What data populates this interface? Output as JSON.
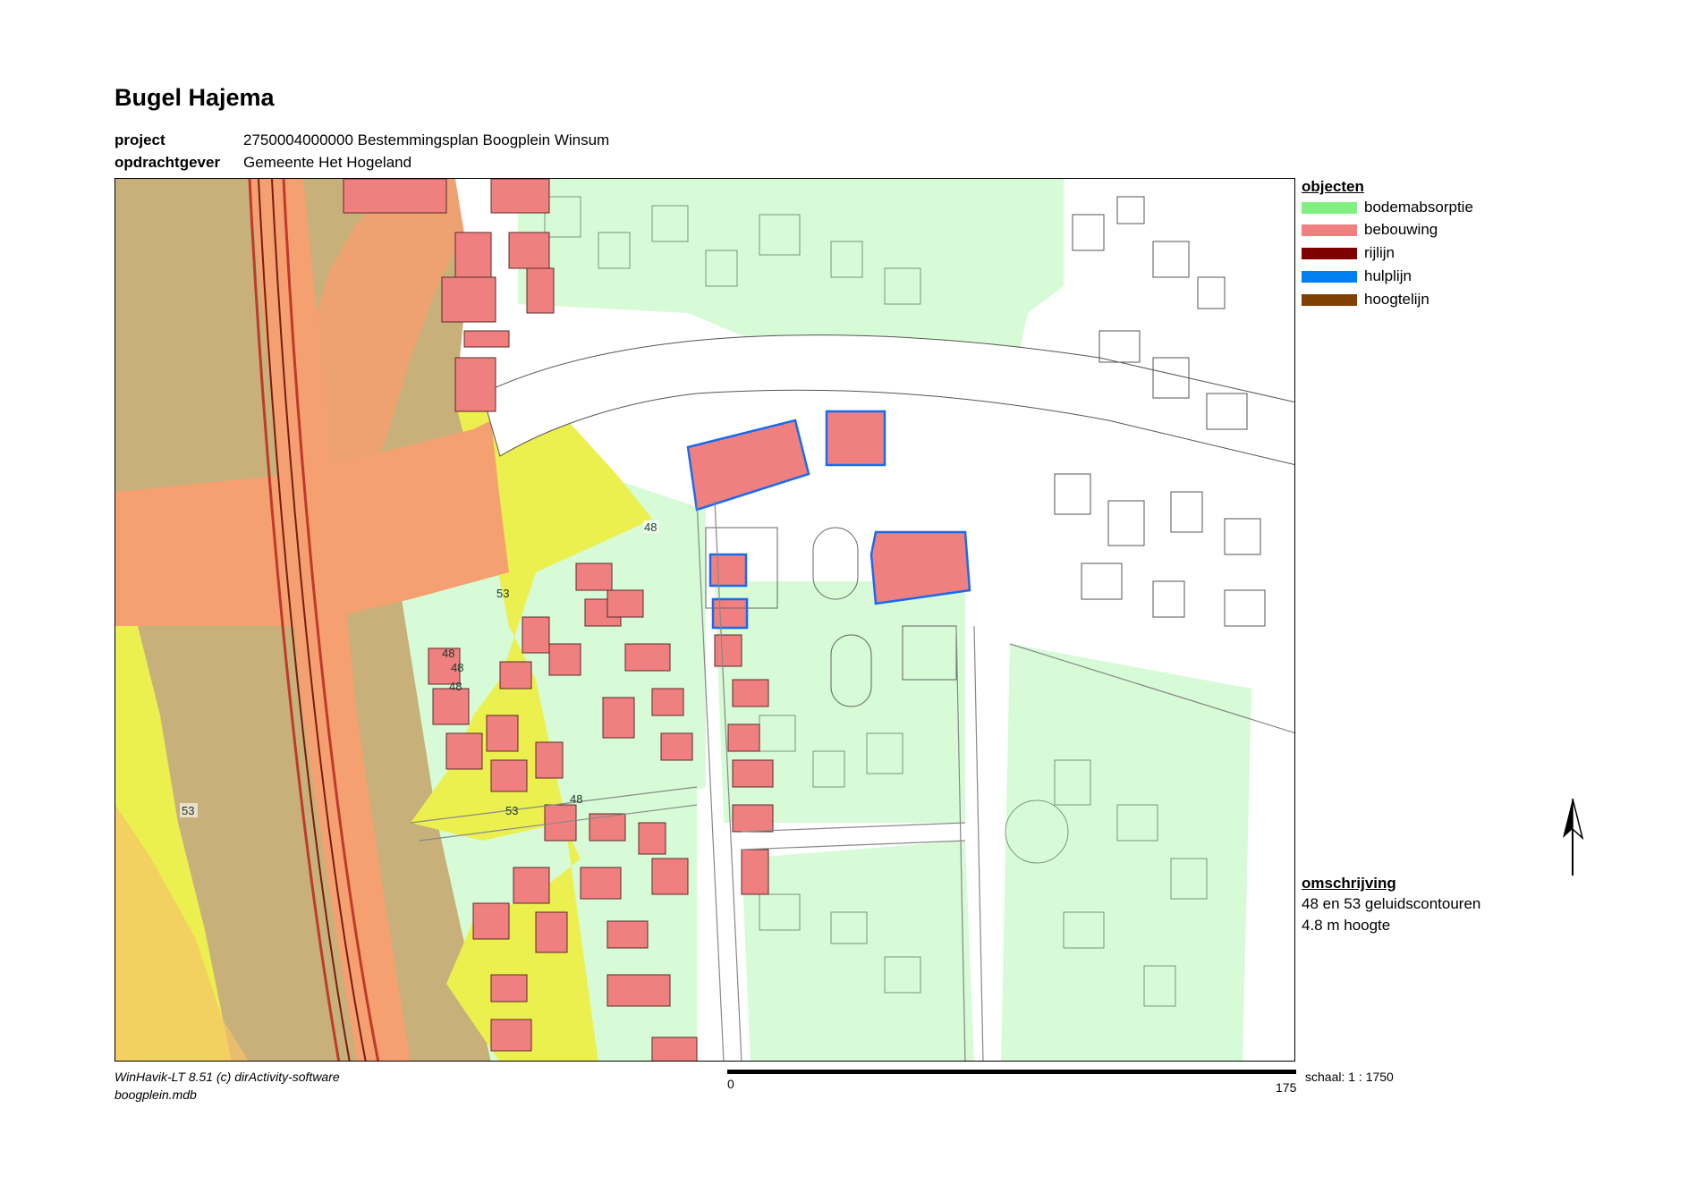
{
  "title": "Bugel Hajema",
  "meta": [
    {
      "label": "project",
      "value": "2750004000000 Bestemmingsplan Boogplein Winsum"
    },
    {
      "label": "opdrachtgever",
      "value": "Gemeente Het Hogeland"
    }
  ],
  "legend": {
    "heading": "objecten",
    "items": [
      {
        "label": "bodemabsorptie",
        "color": "#80f080"
      },
      {
        "label": "bebouwing",
        "color": "#f08080"
      },
      {
        "label": "rijlijn",
        "color": "#800000"
      },
      {
        "label": "hulplijn",
        "color": "#0080f0"
      },
      {
        "label": "hoogtelijn",
        "color": "#804000"
      }
    ]
  },
  "description": {
    "heading": "omschrijving",
    "lines": [
      "48 en 53 geluidscontouren",
      "4.8 m hoogte"
    ]
  },
  "footer": {
    "software": "WinHavik-LT 8.51 (c) dirActivity-software",
    "file": "boogplein.mdb"
  },
  "scalebar": {
    "start": "0",
    "end": "175",
    "scale_label": "schaal:  1 : 1750"
  },
  "map_labels": [
    "48",
    "53",
    "48",
    "48",
    "48",
    "53",
    "53",
    "48"
  ],
  "colors": {
    "zone_53": "#f5a070",
    "zone_48": "#ecf04e",
    "brown_area": "#c8b07a",
    "green_area": "#d6fbd6",
    "building": "#f08080",
    "help_line": "#1a6af0",
    "road_line": "#c0392b"
  }
}
